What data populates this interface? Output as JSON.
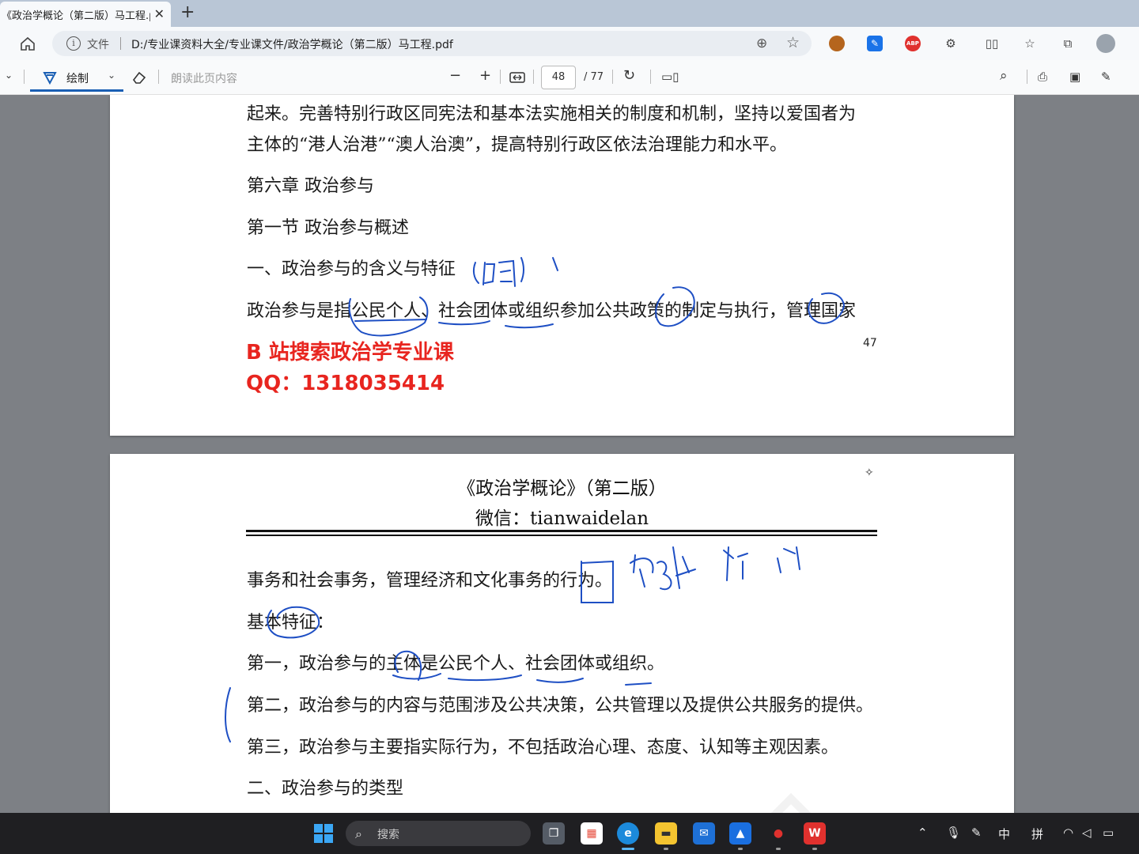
{
  "browser": {
    "tab_title": "《政治学概论（第二版）马工程.pdf",
    "tab_close": "✕",
    "new_tab": "+",
    "file_label": "文件",
    "url": "D:/专业课资料大全/专业课文件/政治学概论（第二版）马工程.pdf"
  },
  "pdf_toolbar": {
    "draw_label": "绘制",
    "read_aloud": "朗读此页内容",
    "zoom_out": "−",
    "zoom_in": "+",
    "page_current": "48",
    "page_total": "/ 77"
  },
  "page1": {
    "lines": [
      "起来。完善特别行政区同宪法和基本法实施相关的制度和机制，坚持以爱国者为",
      "主体的“港人治港”“澳人治澳”，提高特别行政区依法治理能力和水平。",
      "第六章  政治参与",
      "第一节  政治参与概述",
      "一、政治参与的含义与特征",
      "政治参与是指公民个人、社会团体或组织参加公共政策的制定与执行，管理国家"
    ],
    "watermark_line1": "B 站搜索政治学专业课",
    "watermark_line2": "QQ：1318035414",
    "page_number": "47"
  },
  "page2": {
    "header_title": "《政治学概论》（第二版）",
    "header_sub": "微信：tianwaidelan",
    "lines": [
      "事务和社会事务，管理经济和文化事务的行为。",
      "基本特征：",
      "第一，政治参与的主体是公民个人、社会团体或组织。",
      "第二，政治参与的内容与范围涉及公共决策，公共管理以及提供公共服务的提供。",
      "第三，政治参与主要指实际行为，不包括政治心理、态度、认知等主观因素。",
      "二、政治参与的类型"
    ]
  },
  "taskbar": {
    "search_label": "搜索",
    "ime_1": "中",
    "ime_2": "拼"
  },
  "icons": {
    "home": "home-icon",
    "info": "info-icon",
    "zoom": "zoom-icon",
    "favorite": "favorite-icon",
    "draw": "draw-pen-icon",
    "eraser": "eraser-icon",
    "search": "search-icon",
    "print": "print-icon",
    "save": "save-icon",
    "save_as": "save-as-icon"
  },
  "colors": {
    "watermark_red": "#e8251f",
    "ink_blue": "#1e4fc4",
    "accent": "#1a5fb4"
  }
}
